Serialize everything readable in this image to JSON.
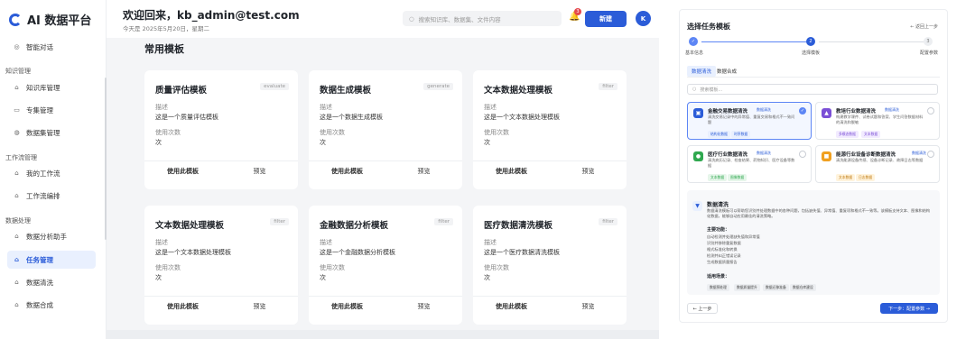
{
  "sidebar": {
    "app_title": "AI 数据平台",
    "top_item": "智能对话",
    "sections": {
      "knowledge": "知识管理",
      "workflow": "工作流管理",
      "data": "数据处理"
    },
    "items": {
      "kb": "知识库管理",
      "topic": "专集管理",
      "dataset": "数据集管理",
      "my_workflow": "我的工作流",
      "workflow_edit": "工作流编排",
      "analysis": "数据分析助手",
      "task": "任务管理",
      "clean": "数据清洗",
      "synth": "数据合成"
    }
  },
  "header": {
    "greeting": "欢迎回来，kb_admin@test.com",
    "date": "今天是 2025年5月20日，星期二",
    "search_placeholder": "搜索知识库、数据集、文件内容",
    "notification_count": "3",
    "new_label": "新建",
    "avatar_letter": "K"
  },
  "main": {
    "section_title": "常用模板",
    "desc_label": "描述",
    "usage_label": "使用次数",
    "use_label": "使用此模板",
    "preview_label": "预览",
    "cards": [
      {
        "title": "质量评估模板",
        "tag": "evaluate",
        "desc": "这是一个质量评估模板",
        "usage": "次"
      },
      {
        "title": "数据生成模板",
        "tag": "generate",
        "desc": "这是一个数据生成模板",
        "usage": "次"
      },
      {
        "title": "文本数据处理模板",
        "tag": "filter",
        "desc": "这是一个文本数据处理模板",
        "usage": "次"
      },
      {
        "title": "文本数据处理模板",
        "tag": "filter",
        "desc": "这是一个文本数据处理模板",
        "usage": "次"
      },
      {
        "title": "金融数据分析模板",
        "tag": "filter",
        "desc": "这是一个金融数据分析模板",
        "usage": "次"
      },
      {
        "title": "医疗数据清洗模板",
        "tag": "filter",
        "desc": "这是一个医疗数据清洗模板",
        "usage": "次"
      }
    ]
  },
  "panel": {
    "title": "选择任务模板",
    "back_label": "← 返回上一步",
    "steps": [
      {
        "num": "✓",
        "label": "基本信息"
      },
      {
        "num": "2",
        "label": "选择模板"
      },
      {
        "num": "3",
        "label": "配置参数"
      }
    ],
    "tabs": [
      "数据清洗",
      "数据合成"
    ],
    "search_placeholder": "搜索模板...",
    "templates": [
      {
        "name": "金融交易数据清洗",
        "badge": "数据清洗",
        "desc": "清洗交易记录中的异常值、重复交易和格式不一致问题",
        "chips": [
          "结构化数据",
          "时序数据"
        ]
      },
      {
        "name": "教培行业数据清洗",
        "badge": "数据清洗",
        "desc": "构建教学课件、试卷试题和答案、学生问答数据材料的清洗和脱敏",
        "chips": [
          "多模态数据",
          "文本数据"
        ]
      },
      {
        "name": "医疗行业数据清洗",
        "badge": "数据清洗",
        "desc": "清洗病历记录、检查结果、药物知识、医疗设备等数据",
        "chips": [
          "文本数据",
          "图像数据"
        ]
      },
      {
        "name": "能源行业设备诊断数据清洗",
        "badge": "数据清洗",
        "desc": "清洗能源设备传感、设备诊断记录、故障日志等数据",
        "chips": [
          "文本数据",
          "日志数据"
        ]
      }
    ],
    "detail": {
      "title": "数据清洗",
      "desc": "数据清洗模板可以帮助您识别并处理数据中的各种问题，包括缺失值、异常值、重复项和格式不一致等。该模板支持文本、图像和结构化数据，能够自动应用最佳的清洗策略。",
      "features_title": "主要功能：",
      "features": [
        "自动检测并处理缺失值和异常值",
        "识别并移除重复数据",
        "格式标准化和转换",
        "检测并纠正错误记录",
        "生成数据质量报告"
      ],
      "scenarios_title": "适用场景：",
      "scenarios": [
        "数据预处理",
        "数据质量提升",
        "数据迁移准备",
        "数据仓库建设"
      ]
    },
    "prev_label": "← 上一步",
    "next_label": "下一步：配置参数 →"
  }
}
